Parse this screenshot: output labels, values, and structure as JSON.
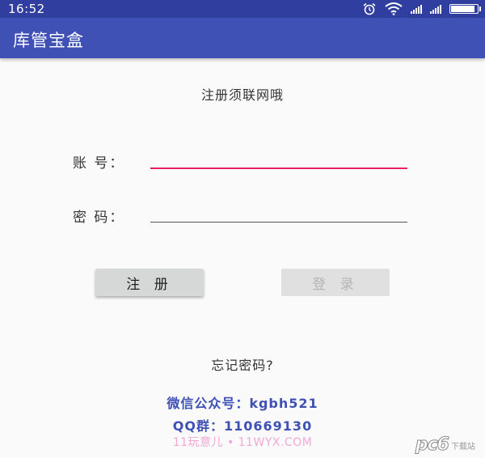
{
  "status_bar": {
    "time": "16:52",
    "battery_level": 0.9,
    "icons": [
      "alarm-icon",
      "wifi-icon",
      "signal-icon",
      "signal-icon",
      "battery-icon"
    ]
  },
  "app_bar": {
    "title": "库管宝盒",
    "color": "#3f51b5",
    "status_color": "#303f9f"
  },
  "notice": "注册须联网哦",
  "form": {
    "account_label": "账 号：",
    "account_value": "",
    "password_label": "密 码：",
    "password_value": "",
    "focus_color": "#e91e63"
  },
  "buttons": {
    "register": "注 册",
    "login": "登 录"
  },
  "forgot_password": "忘记密码?",
  "contact": {
    "wechat": "微信公众号：kgbh521",
    "qq": "QQ群：110669130",
    "color": "#3f51b5"
  },
  "watermark": "11玩意儿 • 11WYX.COM",
  "corner_logo": {
    "main": "pc6",
    "sub": "下载站"
  }
}
